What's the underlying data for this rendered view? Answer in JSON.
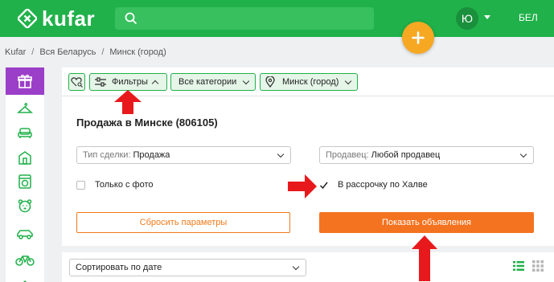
{
  "header": {
    "logo_text": "kufar",
    "avatar_letter": "Ю",
    "language": "БЕЛ",
    "brand_color": "#20b14a",
    "fab_color": "#f7a823"
  },
  "breadcrumb": [
    "Kufar",
    "Вся Беларусь",
    "Минск (город)"
  ],
  "breadcrumb_separator": "/",
  "sidebar": {
    "icons": [
      "gift-icon",
      "hanger-icon",
      "sofa-icon",
      "house-icon",
      "washing-machine-icon",
      "teddy-bear-icon",
      "car-icon",
      "bicycle-icon",
      "chevron-up-icon"
    ]
  },
  "filters": {
    "favorite_icon": "heart-search-icon",
    "filters_label": "Фильтры",
    "categories_label": "Все категории",
    "location_label": "Минск (город)"
  },
  "main": {
    "title": "Продажа в Минске (806105)",
    "deal_type_label": "Тип сделки:",
    "deal_type_value": "Продажа",
    "seller_label": "Продавец:",
    "seller_value": "Любой продавец",
    "only_photo_label": "Только с фото",
    "only_photo_checked": false,
    "halva_label": "В рассрочку по Халве",
    "halva_checked": true,
    "reset_label": "Сбросить параметры",
    "show_label": "Показать объявления",
    "accent_color": "#f47320"
  },
  "sort": {
    "value": "Сортировать по дате"
  }
}
